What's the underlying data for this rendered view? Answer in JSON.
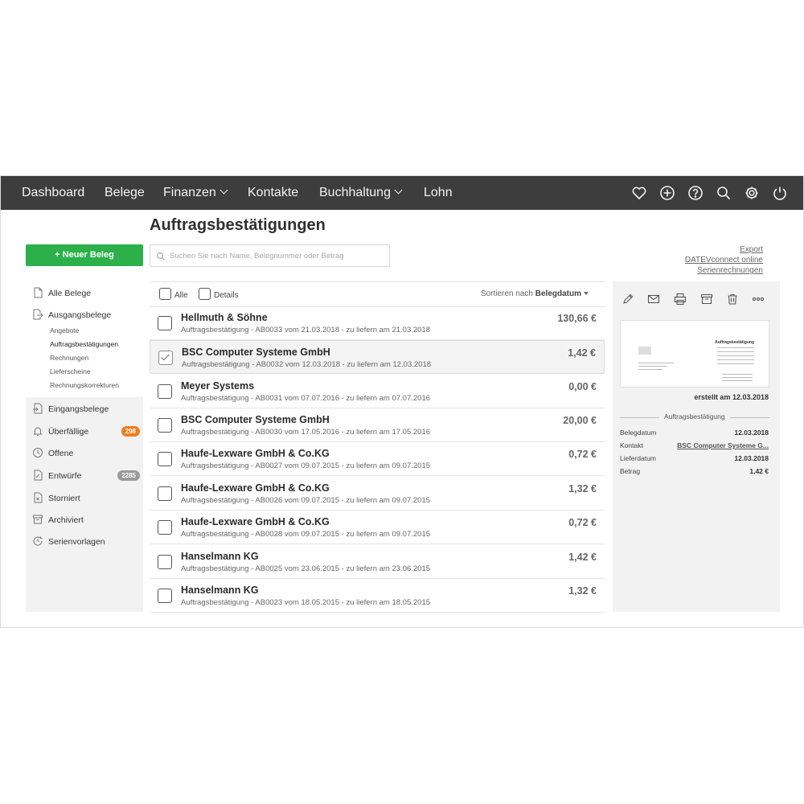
{
  "nav": {
    "items": [
      {
        "label": "Dashboard",
        "dropdown": false
      },
      {
        "label": "Belege",
        "dropdown": false
      },
      {
        "label": "Finanzen",
        "dropdown": true
      },
      {
        "label": "Kontakte",
        "dropdown": false
      },
      {
        "label": "Buchhaltung",
        "dropdown": true
      },
      {
        "label": "Lohn",
        "dropdown": false
      }
    ],
    "icons": [
      "heart-icon",
      "plus-circle-icon",
      "help-icon",
      "search-icon",
      "gear-icon",
      "power-icon"
    ],
    "background": "#3d3d3d"
  },
  "page": {
    "title": "Auftragsbestätigungen"
  },
  "sidebar": {
    "new_button": "+ Neuer Beleg",
    "accent": "#2bb04a",
    "items": {
      "alle": {
        "label": "Alle Belege",
        "icon": "document-icon"
      },
      "ausgang": {
        "label": "Ausgangsbelege",
        "icon": "outgoing-document-icon"
      },
      "eingang": {
        "label": "Eingangsbelege",
        "icon": "incoming-document-icon"
      },
      "ueberfaellige": {
        "label": "Überfällige",
        "icon": "bell-icon",
        "badge": "298"
      },
      "offene": {
        "label": "Offene",
        "icon": "clock-icon"
      },
      "entwuerfe": {
        "label": "Entwürfe",
        "icon": "draft-icon",
        "badge": "2285"
      },
      "storniert": {
        "label": "Storniert",
        "icon": "cancelled-document-icon"
      },
      "archiviert": {
        "label": "Archiviert",
        "icon": "archive-icon"
      },
      "serien": {
        "label": "Serienvorlagen",
        "icon": "recurring-icon"
      }
    },
    "subitems": [
      "Angebote",
      "Auftragsbestätigungen",
      "Rechnungen",
      "Lieferscheine",
      "Rechnungskorrekturen"
    ],
    "badge_colors": {
      "orange": "#f07d1f",
      "gray": "#9a9a9a"
    }
  },
  "search": {
    "placeholder": "Suchen Sie nach Name, Belegnummer oder Betrag",
    "value": ""
  },
  "links": {
    "export": "Export",
    "datev": "DATEVconnect online",
    "serien": "Serienrechnungen"
  },
  "list": {
    "all_label": "Alle",
    "details_label": "Details",
    "sort_prefix": "Sortieren nach",
    "sort_field": "Belegdatum",
    "rows": [
      {
        "name": "Hellmuth & Söhne",
        "sub": "Auftragsbestätigung - AB0033 vom 21.03.2018 - zu liefern am 21.03.2018",
        "amount": "130,66 €",
        "checked": false
      },
      {
        "name": "BSC Computer Systeme GmbH",
        "sub": "Auftragsbestätigung - AB0032 vom 12.03.2018 - zu liefern am 12.03.2018",
        "amount": "1,42 €",
        "checked": true
      },
      {
        "name": "Meyer Systems",
        "sub": "Auftragsbestätigung - AB0031 vom 07.07.2016 - zu liefern am 07.07.2016",
        "amount": "0,00 €",
        "checked": false
      },
      {
        "name": "BSC Computer Systeme GmbH",
        "sub": "Auftragsbestätigung - AB0030 vom 17.05.2016 - zu liefern am 17.05.2016",
        "amount": "20,00 €",
        "checked": false
      },
      {
        "name": "Haufe-Lexware GmbH & Co.KG",
        "sub": "Auftragsbestätigung - AB0027 vom 09.07.2015 - zu liefern am 09.07.2015",
        "amount": "0,72 €",
        "checked": false
      },
      {
        "name": "Haufe-Lexware GmbH & Co.KG",
        "sub": "Auftragsbestätigung - AB0026 vom 09.07.2015 - zu liefern am 09.07.2015",
        "amount": "1,32 €",
        "checked": false
      },
      {
        "name": "Haufe-Lexware GmbH & Co.KG",
        "sub": "Auftragsbestätigung - AB0028 vom 09.07.2015 - zu liefern am 09.07.2015",
        "amount": "0,72 €",
        "checked": false
      },
      {
        "name": "Hanselmann KG",
        "sub": "Auftragsbestätigung - AB0025 vom 23.06.2015 - zu liefern am 23.06.2015",
        "amount": "1,42 €",
        "checked": false
      },
      {
        "name": "Hanselmann KG",
        "sub": "Auftragsbestätigung - AB0023 vom 18.05.2015 - zu liefern am 18.05.2015",
        "amount": "1,32 €",
        "checked": false
      }
    ]
  },
  "detail": {
    "toolbar": [
      "pencil-icon",
      "mail-icon",
      "printer-icon",
      "archive-box-icon",
      "trash-icon",
      "more-icon"
    ],
    "preview_title": "Auftragsbestätigung",
    "created": "erstellt am 12.03.2018",
    "doc_type": "Auftragsbestätigung",
    "meta": [
      {
        "label": "Belegdatum",
        "value": "12.03.2018",
        "link": false
      },
      {
        "label": "Kontakt",
        "value": "BSC Computer Systeme G...",
        "link": true
      },
      {
        "label": "Lieferdatum",
        "value": "12.03.2018",
        "link": false
      },
      {
        "label": "Betrag",
        "value": "1,42 €",
        "link": false
      }
    ]
  }
}
